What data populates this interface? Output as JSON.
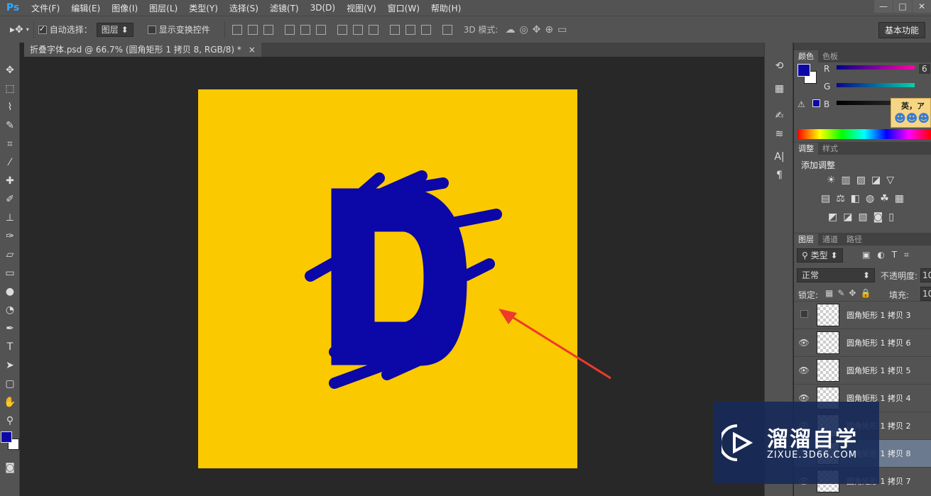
{
  "app": {
    "logo": "Ps"
  },
  "menu": [
    "文件(F)",
    "编辑(E)",
    "图像(I)",
    "图层(L)",
    "类型(Y)",
    "选择(S)",
    "滤镜(T)",
    "3D(D)",
    "视图(V)",
    "窗口(W)",
    "帮助(H)"
  ],
  "window_controls": [
    "—",
    "□",
    "✕"
  ],
  "options": {
    "auto_select_label": "自动选择：",
    "auto_select_value": "图层",
    "show_transform_label": "显示变换控件",
    "mode_3d_label": "3D 模式:",
    "workspace_label": "基本功能"
  },
  "document": {
    "tab_title": "折叠字体.psd @ 66.7% (圆角矩形 1 拷贝 8, RGB/8) *",
    "close": "×",
    "canvas_color": "#fbc900",
    "letter_color": "#0c07a7",
    "letter": "D"
  },
  "panels": {
    "color_tabs": [
      "颜色",
      "色板"
    ],
    "color_channels": [
      "R",
      "G",
      "B"
    ],
    "r_value": "6",
    "adjust_tabs": [
      "调整",
      "样式"
    ],
    "adjust_title": "添加调整",
    "layers_tabs": [
      "图层",
      "通道",
      "路径"
    ],
    "filter_kind": "类型",
    "blend_mode": "正常",
    "opacity_label": "不透明度:",
    "opacity_value": "10",
    "lock_label": "锁定:",
    "fill_label": "填充:",
    "fill_value": "10",
    "layers": [
      {
        "name": "圆角矩形 1 拷贝 3",
        "visible": false
      },
      {
        "name": "圆角矩形 1 拷贝 6",
        "visible": true
      },
      {
        "name": "圆角矩形 1 拷贝 5",
        "visible": true
      },
      {
        "name": "圆角矩形 1 拷贝 4",
        "visible": true
      },
      {
        "name": "圆角矩形 1 拷贝 2",
        "visible": true
      },
      {
        "name": "圆角矩形 1 拷贝 8",
        "visible": true
      },
      {
        "name": "圆角矩形 1 拷贝 7",
        "visible": true
      }
    ]
  },
  "colors": {
    "foreground": "#0c07a7",
    "background": "#ffffff",
    "arrow": "#ee3a2a"
  },
  "ad_sticker": {
    "text": "英，ア"
  },
  "watermark": {
    "title": "溜溜自学",
    "url": "ZIXUE.3D66.COM"
  }
}
